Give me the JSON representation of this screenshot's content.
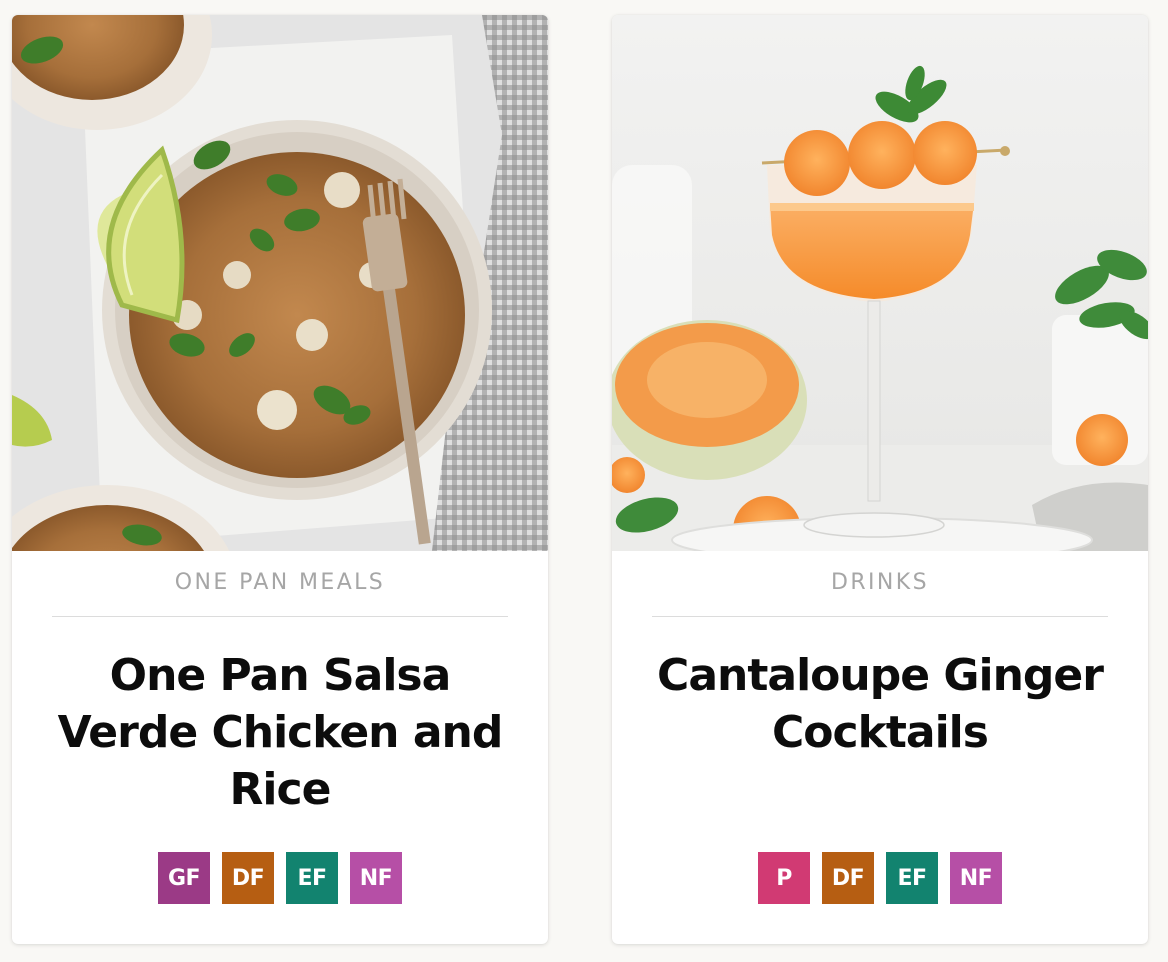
{
  "cards": [
    {
      "image_alt": "Bowl of salsa verde chicken and cauliflower rice with lime and cilantro",
      "category": "ONE PAN MEALS",
      "title": "One Pan Salsa Verde Chicken and Rice",
      "badges": [
        {
          "label": "GF",
          "color": "#9b3a86"
        },
        {
          "label": "DF",
          "color": "#b65e12"
        },
        {
          "label": "EF",
          "color": "#12836f"
        },
        {
          "label": "NF",
          "color": "#b64fa6"
        }
      ]
    },
    {
      "image_alt": "Cantaloupe ginger cocktail in a coupe glass with melon balls and mint",
      "category": "DRINKS",
      "title": "Cantaloupe Ginger Cocktails",
      "badges": [
        {
          "label": "P",
          "color": "#d13a73"
        },
        {
          "label": "DF",
          "color": "#b65e12"
        },
        {
          "label": "EF",
          "color": "#12836f"
        },
        {
          "label": "NF",
          "color": "#b64fa6"
        }
      ]
    }
  ]
}
